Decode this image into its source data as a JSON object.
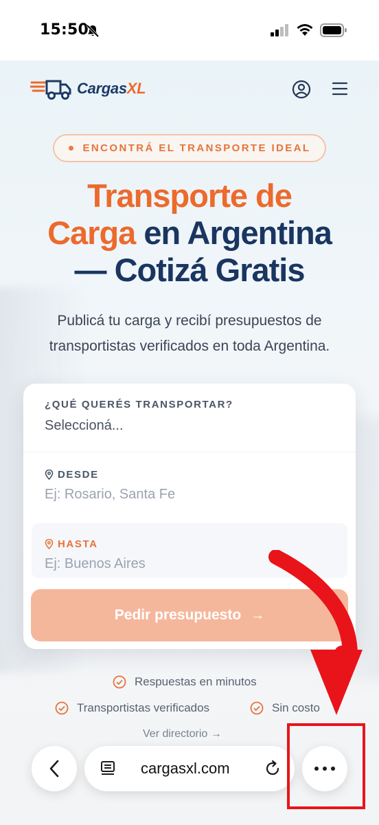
{
  "status_bar": {
    "time": "15:50"
  },
  "header": {
    "logo_brand": "Cargas",
    "logo_suffix": "XL"
  },
  "hero": {
    "pill_text": "ENCONTRÁ EL TRANSPORTE IDEAL",
    "title_line1_orange": "Transporte de",
    "title_line2_orange": "Carga",
    "title_line2_dark": "en Argentina",
    "title_line3_dark": "— Cotizá Gratis",
    "subtitle_line1": "Publicá tu carga y recibí presupuestos de",
    "subtitle_line2": "transportistas verificados en toda Argentina."
  },
  "form": {
    "what_label": "¿QUÉ QUERÉS TRANSPORTAR?",
    "what_value": "Seleccioná...",
    "from_label": "DESDE",
    "from_placeholder": "Ej: Rosario, Santa Fe",
    "to_label": "HASTA",
    "to_placeholder": "Ej: Buenos Aires",
    "submit_label": "Pedir presupuesto",
    "submit_arrow": "→"
  },
  "benefits": [
    "Respuestas en minutos",
    "Transportistas verificados",
    "Sin costo"
  ],
  "directory_link": "Ver directorio →",
  "browser": {
    "url": "cargasxl.com"
  },
  "colors": {
    "brand_orange": "#ec6a2c",
    "brand_navy": "#1a3560",
    "button_disabled": "#f5b79b",
    "annotation_red": "#e8141a"
  }
}
